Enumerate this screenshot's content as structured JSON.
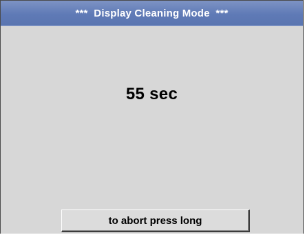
{
  "header": {
    "title": "***  Display Cleaning Mode  ***"
  },
  "main": {
    "countdown": "55 sec"
  },
  "footer": {
    "abort_label": "to abort press long"
  },
  "colors": {
    "title_bar": "#5f7ab6",
    "background": "#d7d7d7",
    "text": "#000000"
  }
}
